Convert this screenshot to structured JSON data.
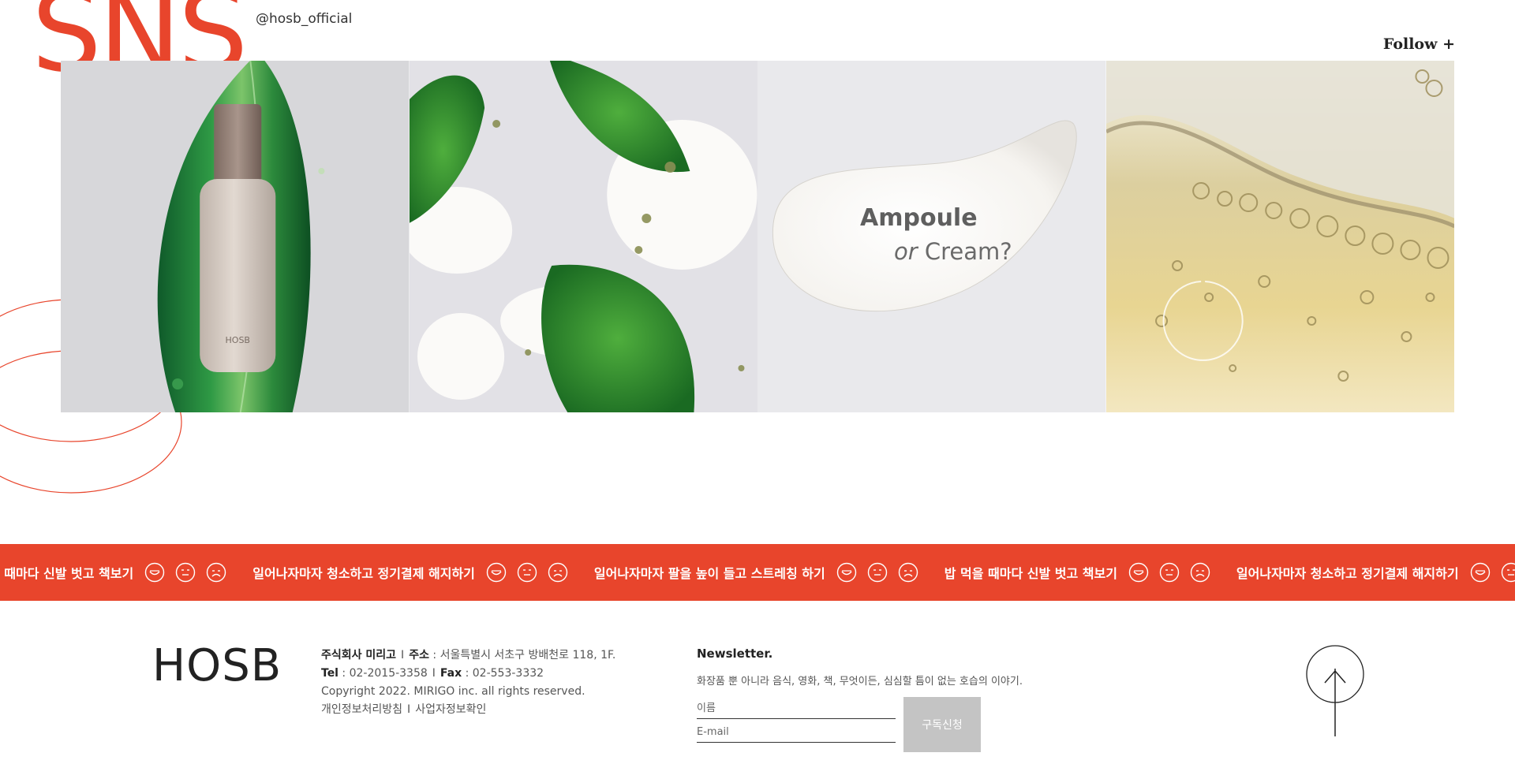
{
  "sns": {
    "title": "SNS",
    "handle": "@hosb_official",
    "follow_label": "Follow +"
  },
  "gallery": {
    "items": [
      {
        "name": "bottle-on-leaf",
        "brand_mark": "HOSB"
      },
      {
        "name": "leaves-and-cream"
      },
      {
        "name": "ampoule-or-cream",
        "line1": "Ampoule",
        "line2_italic": "or",
        "line2_rest": " Cream?"
      },
      {
        "name": "golden-bubbles"
      }
    ]
  },
  "marquee": {
    "items": [
      "밥 먹을 때마다 신발 벗고 책보기",
      "일어나자마자 청소하고 정기결제 해지하기",
      "일어나자마자 팔을 높이 들고 스트레칭 하기",
      "밥 먹을 때마다 신발 벗고 책보기",
      "일어나자마자 청소하고 정기결제 해지하기",
      "일어나자마자 팔을 높이 들고 스트레칭 하기"
    ]
  },
  "footer": {
    "logo": "HOSB",
    "company_label": "주식회사 미리고",
    "address_label": "주소",
    "address_value": " : 서울특별시 서초구 방배천로 118, 1F.",
    "tel_label": "Tel",
    "tel_value": " : 02-2015-3358",
    "fax_label": "Fax",
    "fax_value": " : 02-553-3332",
    "copyright": "Copyright 2022. MIRIGO inc. all rights reserved.",
    "privacy_link": "개인정보처리방침",
    "business_link": "사업자정보확인",
    "separator": "I"
  },
  "newsletter": {
    "title": "Newsletter.",
    "description": "화장품 뿐 아니라 음식, 영화, 책, 무엇이든, 심심할 틈이 없는 호습의 이야기.",
    "name_placeholder": "이름",
    "email_placeholder": "E-mail",
    "submit_label": "구독신청"
  },
  "icons": {
    "top": "arrow-up-icon",
    "faces": [
      "smile-face-icon",
      "neutral-face-icon",
      "sad-face-icon"
    ]
  },
  "colors": {
    "accent": "#e8452c",
    "button_gray": "#c4c4c4"
  }
}
